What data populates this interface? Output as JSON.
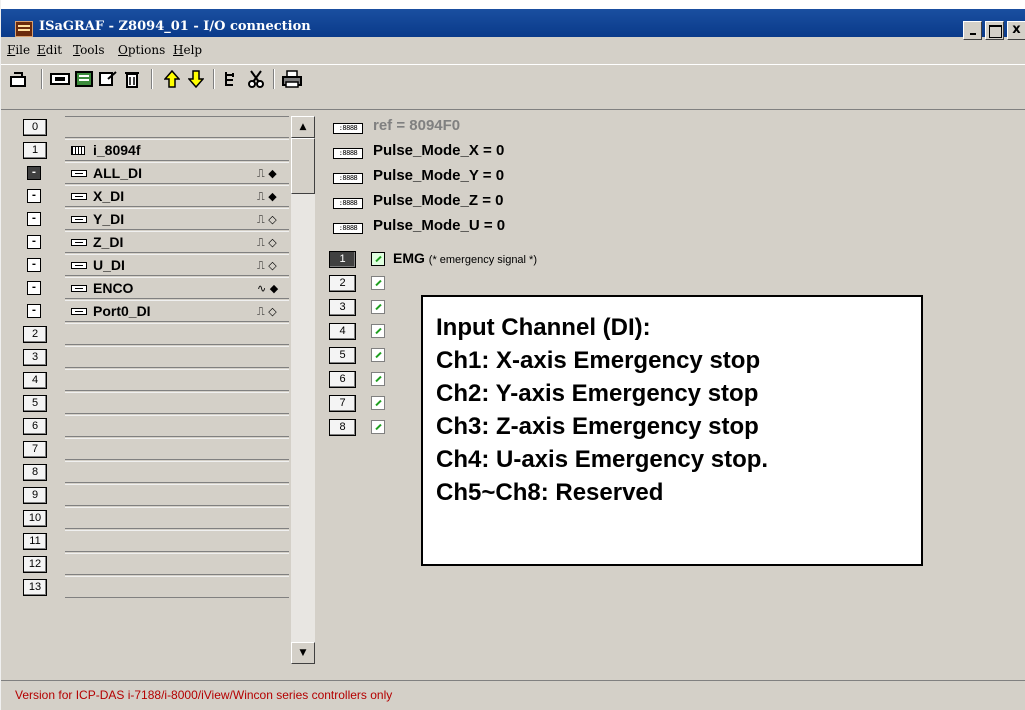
{
  "window": {
    "title": "ISaGRAF - Z8094_01 - I/O connection",
    "buttons": {
      "minimize": "",
      "maximize": "",
      "close": "x"
    }
  },
  "menu": [
    {
      "label": "File",
      "key": "F"
    },
    {
      "label": "Edit",
      "key": "E"
    },
    {
      "label": "Tools",
      "key": "T"
    },
    {
      "label": "Options",
      "key": "O"
    },
    {
      "label": "Help",
      "key": "H"
    }
  ],
  "toolbar": {
    "icons": [
      "open-board-icon",
      "board-icon",
      "board-params-icon",
      "connect-icon",
      "delete-icon",
      "move-up-icon",
      "move-down-icon",
      "tree-icon",
      "cut-icon",
      "print-icon"
    ]
  },
  "slots": [
    {
      "num": "0",
      "label": ""
    },
    {
      "num": "1",
      "label": "i_8094f"
    },
    {
      "num": "2",
      "label": ""
    },
    {
      "num": "3",
      "label": ""
    },
    {
      "num": "4",
      "label": ""
    },
    {
      "num": "5",
      "label": ""
    },
    {
      "num": "6",
      "label": ""
    },
    {
      "num": "7",
      "label": ""
    },
    {
      "num": "8",
      "label": ""
    },
    {
      "num": "9",
      "label": ""
    },
    {
      "num": "10",
      "label": ""
    },
    {
      "num": "11",
      "label": ""
    },
    {
      "num": "12",
      "label": ""
    },
    {
      "num": "13",
      "label": ""
    }
  ],
  "sub_modules": [
    {
      "btn": "-",
      "label": "ALL_DI",
      "signal": "⎍ ◆",
      "active": true
    },
    {
      "btn": "-",
      "label": "X_DI",
      "signal": "⎍ ◆"
    },
    {
      "btn": "-",
      "label": "Y_DI",
      "signal": "⎍ ◇"
    },
    {
      "btn": "-",
      "label": "Z_DI",
      "signal": "⎍ ◇"
    },
    {
      "btn": "-",
      "label": "U_DI",
      "signal": "⎍ ◇"
    },
    {
      "btn": "-",
      "label": "ENCO",
      "signal": "∿ ◆"
    },
    {
      "btn": "-",
      "label": "Port0_DI",
      "signal": "⎍ ◇"
    }
  ],
  "params": [
    {
      "icon": ":8888",
      "text": "ref = 8094F0",
      "gray": true
    },
    {
      "icon": ":8888",
      "text": "Pulse_Mode_X = 0"
    },
    {
      "icon": ":8888",
      "text": "Pulse_Mode_Y = 0"
    },
    {
      "icon": ":8888",
      "text": "Pulse_Mode_Z = 0"
    },
    {
      "icon": ":8888",
      "text": "Pulse_Mode_U = 0"
    }
  ],
  "channels": [
    {
      "num": "1",
      "label": "EMG",
      "comment": "(* emergency signal *)",
      "active": true
    },
    {
      "num": "2",
      "label": ""
    },
    {
      "num": "3",
      "label": ""
    },
    {
      "num": "4",
      "label": ""
    },
    {
      "num": "5",
      "label": ""
    },
    {
      "num": "6",
      "label": ""
    },
    {
      "num": "7",
      "label": ""
    },
    {
      "num": "8",
      "label": ""
    }
  ],
  "note": {
    "lines": [
      "Input Channel (DI):",
      "Ch1: X-axis Emergency stop",
      "Ch2: Y-axis Emergency stop",
      "Ch3: Z-axis Emergency stop",
      "Ch4: U-axis Emergency stop.",
      "Ch5~Ch8: Reserved"
    ]
  },
  "status": {
    "text": "Version for ICP-DAS i-7188/i-8000/iView/Wincon series controllers only"
  },
  "colors": {
    "titlebar": "#0a3a8a",
    "status_text": "#b40000",
    "window_bg": "#d4d0c8"
  }
}
